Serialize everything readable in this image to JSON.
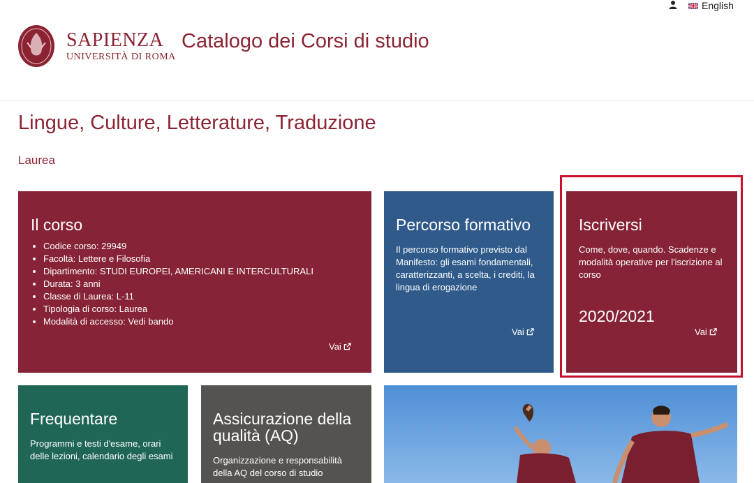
{
  "utility": {
    "language_label": "English",
    "user_icon": "user-icon",
    "flag_icon": "uk-flag-icon"
  },
  "header": {
    "brand_name": "SAPIENZA",
    "brand_sub": "UNIVERSITÀ DI ROMA",
    "site_title": "Catalogo dei Corsi di studio"
  },
  "page": {
    "title": "Lingue, Culture, Letterature, Traduzione",
    "degree": "Laurea"
  },
  "cards": {
    "corso": {
      "title": "Il corso",
      "items": [
        "Codice corso: 29949",
        "Facoltà: Lettere e Filosofia",
        "Dipartimento: STUDI EUROPEI, AMERICANI E INTERCULTURALI",
        "Durata: 3 anni",
        "Classe di Laurea: L-11",
        "Tipologia di corso: Laurea",
        "Modalità di accesso: Vedi bando"
      ],
      "link": "Vai"
    },
    "percorso": {
      "title": "Percorso formativo",
      "text": "Il percorso formativo previsto dal Manifesto: gli esami fondamentali, caratterizzanti, a scelta, i crediti, la lingua di erogazione",
      "link": "Vai"
    },
    "iscriversi": {
      "title": "Iscriversi",
      "text": "Come, dove, quando. Scadenze e modalità operative per l'iscrizione al corso",
      "year": "2020/2021",
      "link": "Vai"
    },
    "frequentare": {
      "title": "Frequentare",
      "text": "Programmi e testi d'esame, orari delle lezioni, calendario degli esami"
    },
    "aq": {
      "title": "Assicurazione della qualità (AQ)",
      "text": "Organizzazione e responsabilità della AQ del corso di studio"
    }
  },
  "colors": {
    "brand": "#8b2332",
    "card_red": "#862336",
    "card_blue": "#2f5a8a",
    "card_green": "#1f6656",
    "card_gray": "#555350",
    "highlight": "#c8102e"
  }
}
